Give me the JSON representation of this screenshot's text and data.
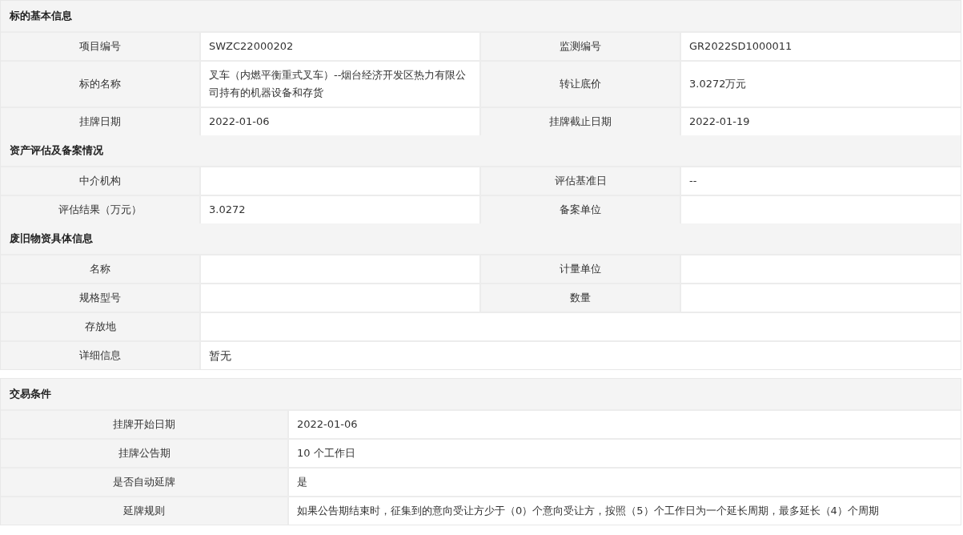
{
  "panels": [
    {
      "kind": "four_column",
      "sections": [
        {
          "title": "标的基本信息",
          "rows": [
            {
              "pairs": [
                {
                  "label": "项目编号",
                  "value": "SWZC22000202"
                },
                {
                  "label": "监测编号",
                  "value": "GR2022SD1000011"
                }
              ]
            },
            {
              "pairs": [
                {
                  "label": "标的名称",
                  "value": "叉车（内燃平衡重式叉车）--烟台经济开发区热力有限公司持有的机器设备和存货"
                },
                {
                  "label": "转让底价",
                  "value": "3.0272万元"
                }
              ]
            },
            {
              "pairs": [
                {
                  "label": "挂牌日期",
                  "value": "2022-01-06"
                },
                {
                  "label": "挂牌截止日期",
                  "value": "2022-01-19"
                }
              ]
            }
          ]
        },
        {
          "title": "资产评估及备案情况",
          "rows": [
            {
              "pairs": [
                {
                  "label": "中介机构"
                },
                {
                  "label": "评估基准日",
                  "value": "--"
                }
              ]
            },
            {
              "pairs": [
                {
                  "label": "评估结果（万元）",
                  "value": "3.0272"
                },
                {
                  "label": "备案单位"
                }
              ]
            }
          ]
        },
        {
          "title": "废旧物资具体信息",
          "rows": [
            {
              "pairs": [
                {
                  "label": "名称"
                },
                {
                  "label": "计量单位"
                }
              ]
            },
            {
              "pairs": [
                {
                  "label": "规格型号"
                },
                {
                  "label": "数量"
                }
              ]
            },
            {
              "pairs": [
                {
                  "label": "存放地"
                }
              ]
            },
            {
              "pairs": [
                {
                  "label": "详细信息",
                  "value": "暂无"
                }
              ]
            }
          ]
        }
      ]
    },
    {
      "kind": "two_column",
      "sections": [
        {
          "title": "交易条件",
          "rows": [
            {
              "pairs": [
                {
                  "label": "挂牌开始日期",
                  "value": "2022-01-06"
                }
              ]
            },
            {
              "pairs": [
                {
                  "label": "挂牌公告期",
                  "value": "10 个工作日"
                }
              ]
            },
            {
              "pairs": [
                {
                  "label": "是否自动延牌",
                  "value": "是"
                }
              ]
            },
            {
              "pairs": [
                {
                  "label": "延牌规则",
                  "value": "如果公告期结束时，征集到的意向受让方少于（0）个意向受让方，按照（5）个工作日为一个延长周期，最多延长（4）个周期"
                }
              ]
            }
          ]
        }
      ]
    }
  ]
}
